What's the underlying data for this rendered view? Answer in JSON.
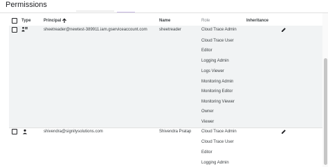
{
  "page": {
    "title": "Permissions"
  },
  "table": {
    "columns": {
      "type": "Type",
      "principal": "Principal",
      "name": "Name",
      "role": "Role",
      "inheritance": "Inheritance"
    },
    "rows": [
      {
        "principal": "sheetreader@newtest-389911.iam.gserviceaccount.com",
        "name": "sheetreader",
        "roles": [
          "Cloud Trace Admin",
          "Cloud Trace User",
          "Editor",
          "Logging Admin",
          "Logs Viewer",
          "Monitoring Admin",
          "Monitoring Editor",
          "Monitoring Viewer",
          "Owner",
          "Viewer"
        ]
      },
      {
        "principal": "shivendra@signitysolutions.com",
        "name": "Shivendra Pratap",
        "roles": [
          "Cloud Trace Admin",
          "Cloud Trace User",
          "Editor",
          "Logging Admin"
        ]
      }
    ]
  }
}
